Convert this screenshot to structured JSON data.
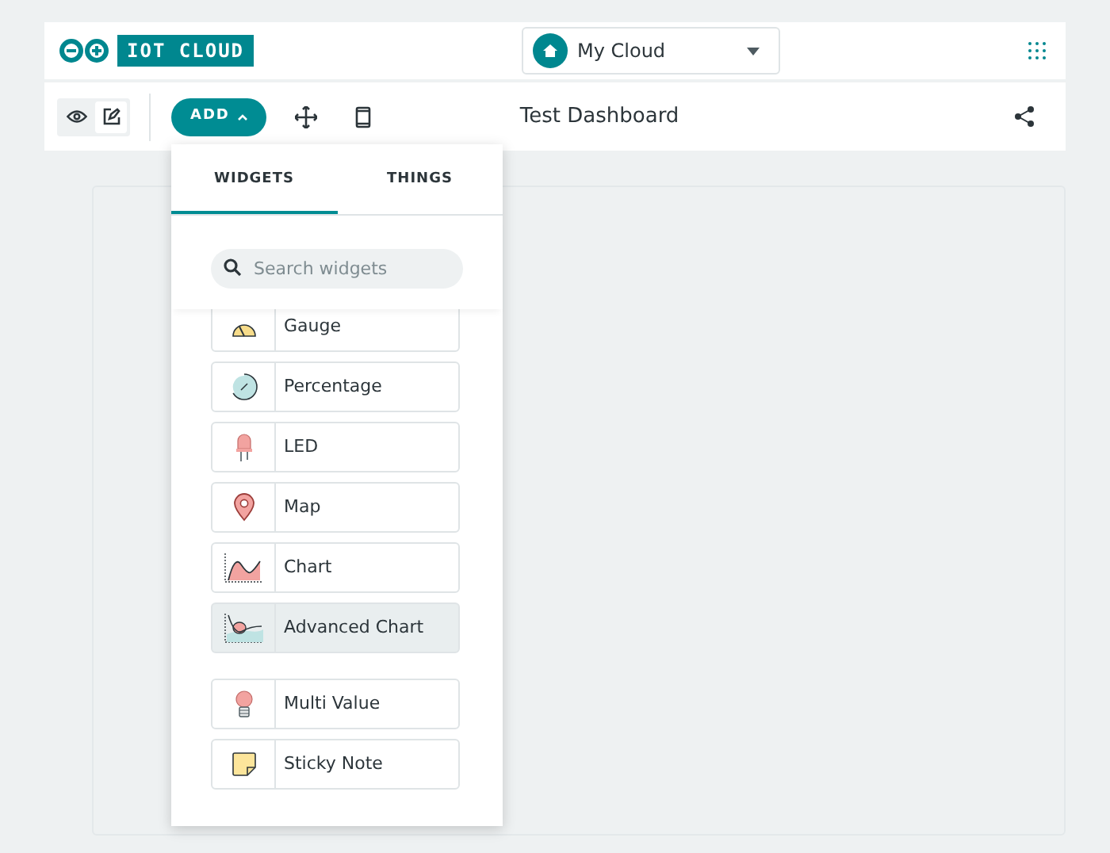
{
  "header": {
    "logo_text": "IOT CLOUD",
    "space": "My Cloud"
  },
  "toolbar": {
    "modes": [
      {
        "kind": "view",
        "selected": false
      },
      {
        "kind": "edit",
        "selected": true
      }
    ],
    "add_button": "ADD",
    "title": "Test Dashboard"
  },
  "add_menu": {
    "tabs": [
      {
        "label": "WIDGETS",
        "selected": true
      },
      {
        "label": "THINGS",
        "selected": false
      }
    ],
    "search": {
      "placeholder": "Search widgets"
    },
    "widget_groups": [
      [
        {
          "kind": "gauge",
          "label": "Gauge",
          "selected": false
        },
        {
          "kind": "percentage",
          "label": "Percentage",
          "selected": false
        },
        {
          "kind": "led",
          "label": "LED",
          "selected": false
        },
        {
          "kind": "map",
          "label": "Map",
          "selected": false
        },
        {
          "kind": "chart",
          "label": "Chart",
          "selected": false
        },
        {
          "kind": "advanced_chart",
          "label": "Advanced Chart",
          "selected": true
        }
      ],
      [
        {
          "kind": "multi_value",
          "label": "Multi Value",
          "selected": false
        },
        {
          "kind": "sticky_note",
          "label": "Sticky Note",
          "selected": false
        }
      ]
    ]
  }
}
